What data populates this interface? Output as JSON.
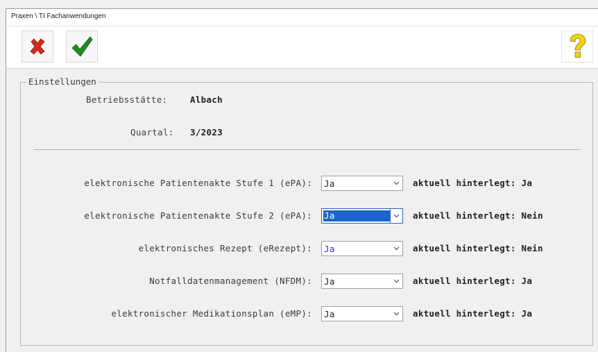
{
  "window": {
    "title": "Praxen \\ TI Fachanwendungen"
  },
  "toolbar": {
    "cancel_icon": "red-x-icon",
    "ok_icon": "green-checkmark-icon",
    "help_icon": "yellow-question-mark-icon",
    "colors": {
      "cancel": "#d42a1e",
      "ok": "#1e8c1e",
      "help": "#f2d21a"
    }
  },
  "settings": {
    "legend": "Einstellungen",
    "betriebsstaette_label": "Betriebsstätte:",
    "betriebsstaette_value": "Albach",
    "quartal_label": "Quartal:",
    "quartal_value": "3/2023"
  },
  "rows": [
    {
      "label": "elektronische Patientenakte Stufe 1 (ePA):",
      "value": "Ja",
      "stored": "aktuell hinterlegt: Ja"
    },
    {
      "label": "elektronische Patientenakte Stufe 2 (ePA):",
      "value": "Ja",
      "stored": "aktuell hinterlegt: Nein"
    },
    {
      "label": "elektronisches Rezept (eRezept):",
      "value": "Ja",
      "stored": "aktuell hinterlegt: Nein"
    },
    {
      "label": "Notfalldatenmanagement (NFDM):",
      "value": "Ja",
      "stored": "aktuell hinterlegt: Ja"
    },
    {
      "label": "elektronischer Medikationsplan (eMP):",
      "value": "Ja",
      "stored": "aktuell hinterlegt: Ja"
    }
  ],
  "colors": {
    "selection": "#1a66cc",
    "combo_text_blue": "#3535b5"
  }
}
